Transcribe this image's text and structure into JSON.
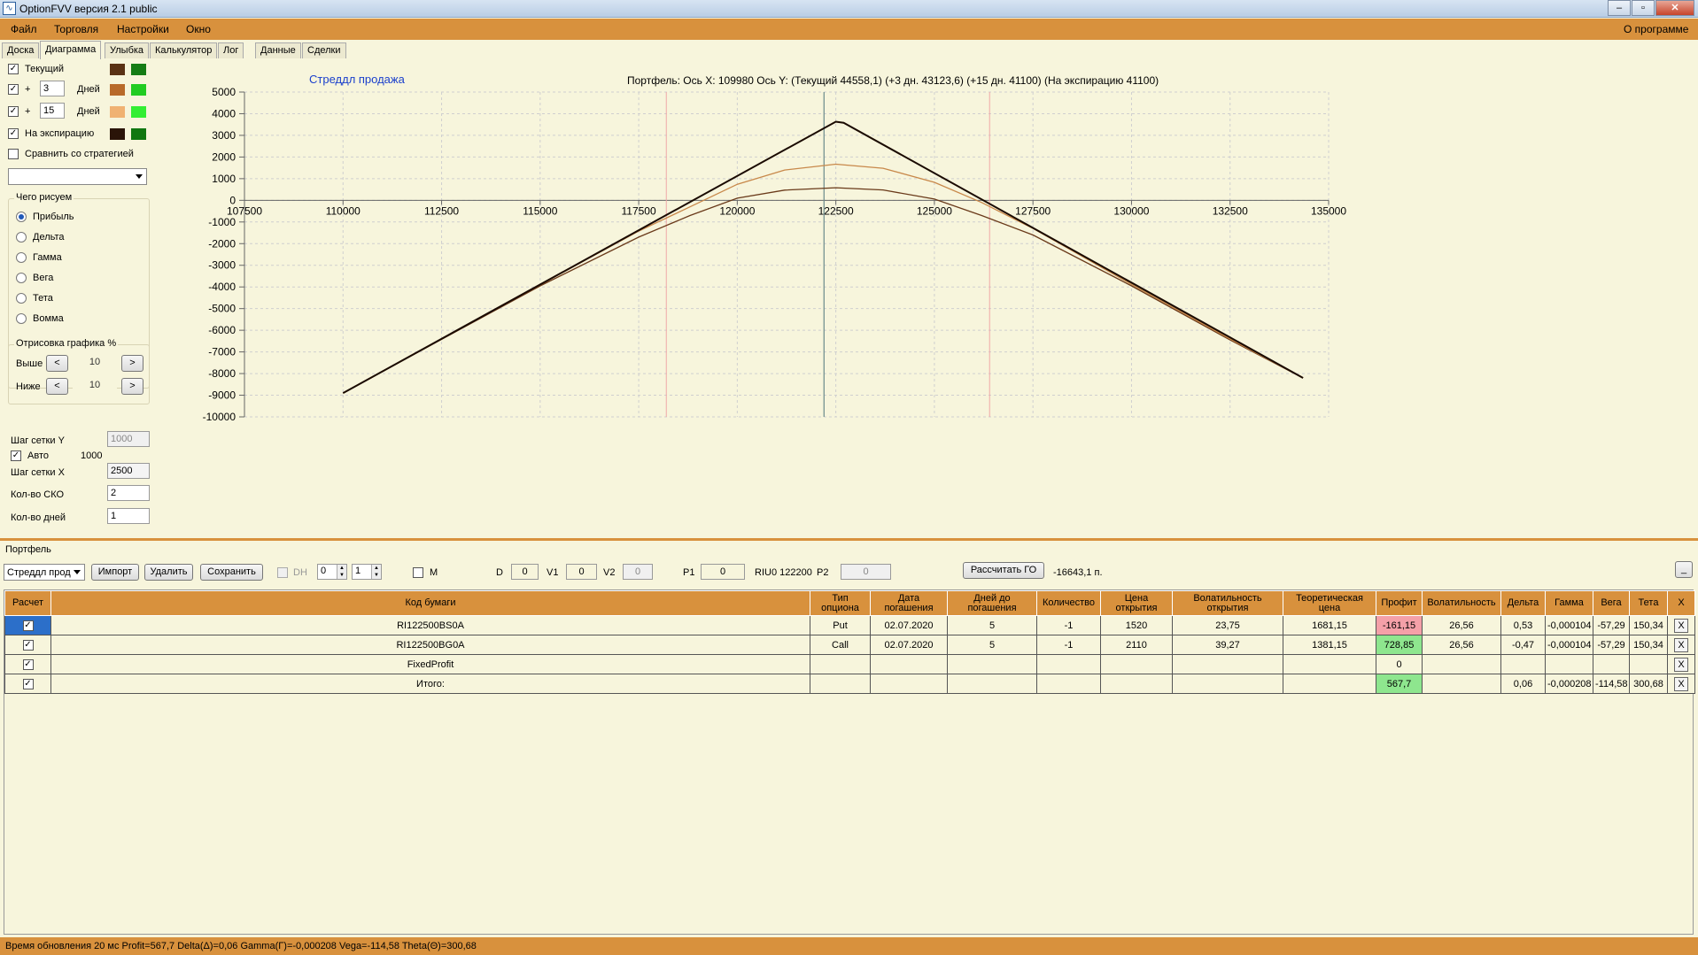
{
  "window": {
    "title": "OptionFVV версия 2.1 public"
  },
  "menu": {
    "file": "Файл",
    "trade": "Торговля",
    "settings": "Настройки",
    "window": "Окно",
    "about": "О программе"
  },
  "tabs": [
    "Доска",
    "Диаграмма",
    "Улыбка",
    "Калькулятор",
    "Лог",
    "Данные",
    "Сделки"
  ],
  "left": {
    "current": "Текущий",
    "plus1": "+",
    "days1": "3",
    "days_lbl1": "Дней",
    "plus2": "+",
    "days2": "15",
    "days_lbl2": "Дней",
    "expiry": "На экспирацию",
    "compare": "Сравнить со стратегией",
    "draw_group": "Чего рисуем",
    "radios": [
      "Прибыль",
      "Дельта",
      "Гамма",
      "Вега",
      "Тета",
      "Вомма"
    ],
    "render_group": "Отрисовка графика %",
    "above": "Выше",
    "above_val": "10",
    "below": "Ниже",
    "below_val": "10",
    "btn_left": "<",
    "btn_right": ">",
    "grid_y_lbl": "Шаг сетки Y",
    "grid_y_val": "1000",
    "auto_lbl": "Авто",
    "auto_val": "1000",
    "grid_x_lbl": "Шаг сетки X",
    "grid_x_val": "2500",
    "sko_lbl": "Кол-во СКО",
    "sko_val": "2",
    "days_lbl": "Кол-во дней",
    "days_val": "1",
    "colors": {
      "current_a": "#5a3214",
      "current_b": "#157c15",
      "d3_a": "#b86a2a",
      "d3_b": "#22cc22",
      "d15_a": "#f0b272",
      "d15_b": "#33ee33",
      "exp_a": "#2a1408",
      "exp_b": "#117711"
    }
  },
  "chart_header": {
    "strategy": "Стреддл продажа",
    "info": "Портфель: Ось X:  109980 Ось Y:   (Текущий 44558,1)  (+3 дн. 43123,6)  (+15 дн. 41100)  (На экспирацию 41100)"
  },
  "chart_data": {
    "type": "line",
    "xlim": [
      107500,
      135000
    ],
    "ylim": [
      -10000,
      5000
    ],
    "x_ticks": [
      107500,
      110000,
      112500,
      115000,
      117500,
      120000,
      122500,
      125000,
      127500,
      130000,
      132500,
      135000
    ],
    "y_ticks": [
      5000,
      4000,
      3000,
      2000,
      1000,
      0,
      -1000,
      -2000,
      -3000,
      -4000,
      -5000,
      -6000,
      -7000,
      -8000,
      -9000,
      -10000
    ],
    "red_vlines": [
      118200,
      126400
    ],
    "gray_vline": 122200,
    "grid": true,
    "series": [
      {
        "color": "#1a0a00",
        "width": 2,
        "points": [
          [
            110000,
            -8900
          ],
          [
            122500,
            3630
          ],
          [
            122700,
            3580
          ],
          [
            134350,
            -8200
          ]
        ]
      },
      {
        "color": "#c8884a",
        "width": 1.3,
        "points": [
          [
            110000,
            -8900
          ],
          [
            112500,
            -6400
          ],
          [
            115000,
            -3900
          ],
          [
            117500,
            -1420
          ],
          [
            118800,
            -300
          ],
          [
            120000,
            740
          ],
          [
            121200,
            1400
          ],
          [
            122500,
            1670
          ],
          [
            123700,
            1480
          ],
          [
            125000,
            830
          ],
          [
            126200,
            -100
          ],
          [
            127500,
            -1300
          ],
          [
            130000,
            -3880
          ],
          [
            132500,
            -6400
          ],
          [
            134350,
            -8200
          ]
        ]
      },
      {
        "color": "#6a3a1a",
        "width": 1.3,
        "points": [
          [
            110000,
            -8900
          ],
          [
            112500,
            -6420
          ],
          [
            115000,
            -3950
          ],
          [
            117500,
            -1700
          ],
          [
            118800,
            -700
          ],
          [
            120000,
            100
          ],
          [
            121200,
            470
          ],
          [
            122500,
            580
          ],
          [
            123700,
            480
          ],
          [
            125000,
            60
          ],
          [
            126200,
            -700
          ],
          [
            127500,
            -1600
          ],
          [
            130000,
            -3950
          ],
          [
            132500,
            -6450
          ],
          [
            134350,
            -8200
          ]
        ]
      }
    ]
  },
  "portfolio": {
    "label": "Портфель",
    "strategy_select": "Стреддл прод",
    "import": "Импорт",
    "delete": "Удалить",
    "save": "Сохранить",
    "dh": "DH",
    "spin1": "0",
    "spin2": "1",
    "m": "M",
    "d_lbl": "D",
    "d_val": "0",
    "v1_lbl": "V1",
    "v1_val": "0",
    "v2_lbl": "V2",
    "v2_val": "0",
    "p1_lbl": "P1",
    "p1_val": "0",
    "riu": "RIU0 122200",
    "p2_lbl": "P2",
    "p2_val": "0",
    "go_btn": "Рассчитать ГО",
    "go_val": "-16643,1 п.",
    "collapse": "_"
  },
  "table": {
    "headers": [
      "Расчет",
      "Код бумаги",
      "Тип опциона",
      "Дата погашения",
      "Дней до погашения",
      "Количество",
      "Цена открытия",
      "Волатильность открытия",
      "Теоретическая цена",
      "Профит",
      "Волатильность",
      "Дельта",
      "Гамма",
      "Вега",
      "Тета",
      "X"
    ],
    "rows": [
      [
        "RI122500BS0A",
        "Put",
        "02.07.2020",
        "5",
        "-1",
        "1520",
        "23,75",
        "1681,15",
        "-161,15",
        "26,56",
        "0,53",
        "-0,000104",
        "-57,29",
        "150,34"
      ],
      [
        "RI122500BG0A",
        "Call",
        "02.07.2020",
        "5",
        "-1",
        "2110",
        "39,27",
        "1381,15",
        "728,85",
        "26,56",
        "-0,47",
        "-0,000104",
        "-57,29",
        "150,34"
      ],
      [
        "FixedProfit",
        "",
        "",
        "",
        "",
        "",
        "",
        "",
        "0",
        "",
        "",
        "",
        "",
        ""
      ],
      [
        "Итого:",
        "",
        "",
        "",
        "",
        "",
        "",
        "",
        "567,7",
        "",
        "0,06",
        "-0,000208",
        "-114,58",
        "300,68"
      ]
    ],
    "x": "X"
  },
  "status": "Время обновления 20 мс  Profit=567,7 Delta(Δ)=0,06 Gamma(Γ)=-0,000208 Vega=-114,58 Theta(Θ)=300,68"
}
